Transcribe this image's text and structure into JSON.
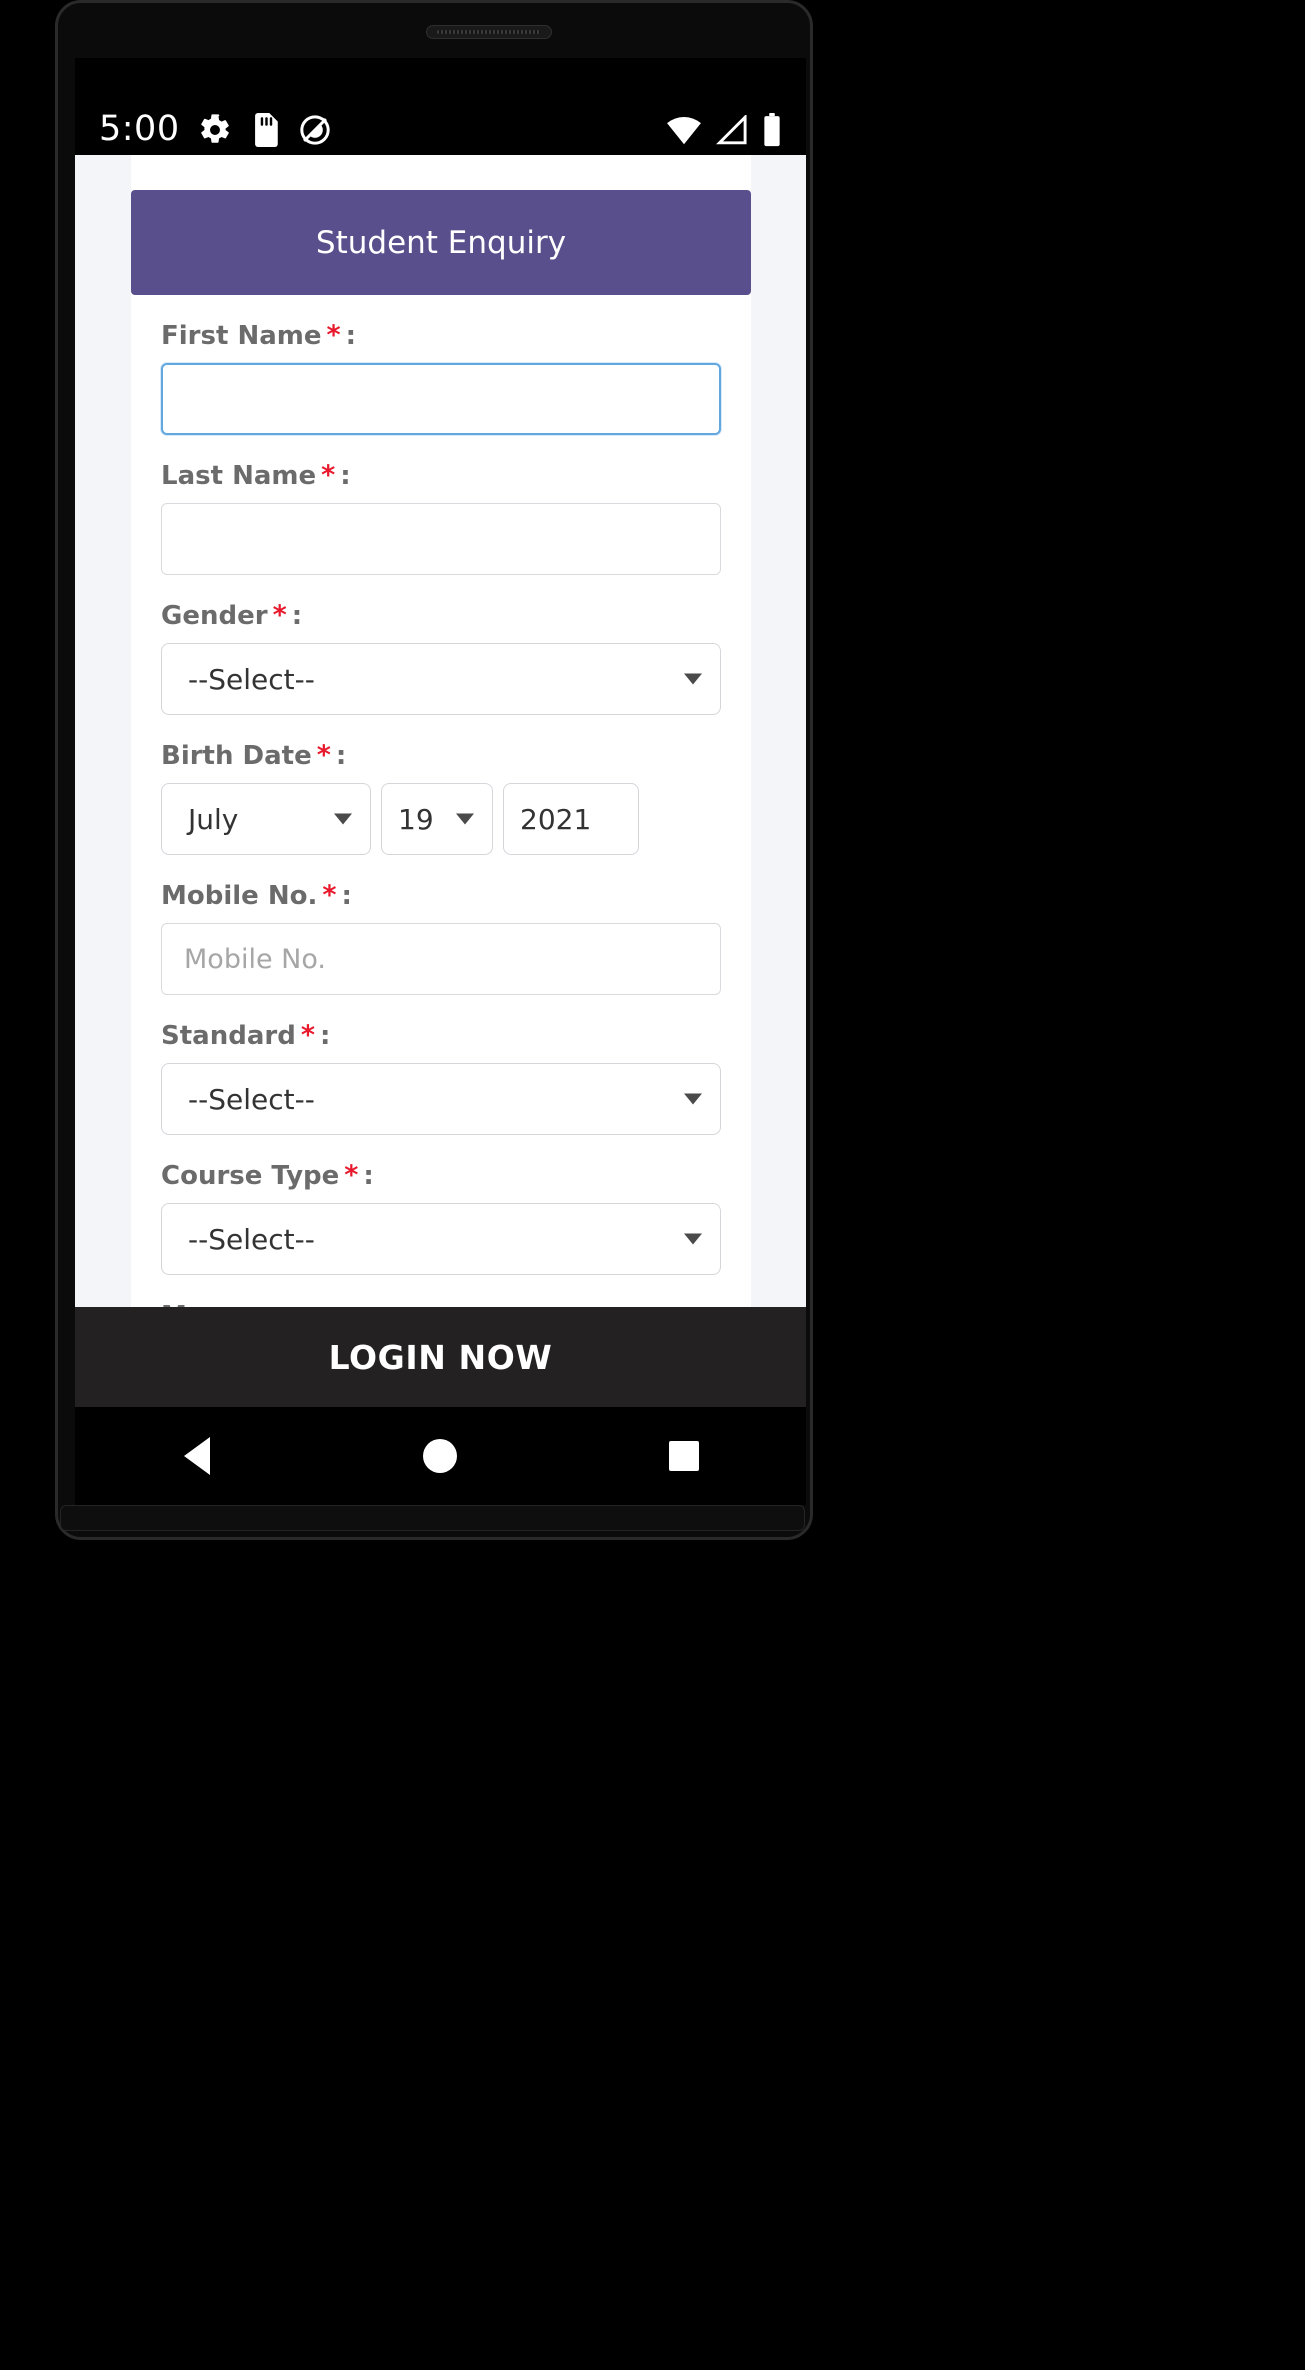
{
  "device": {
    "statusbar": {
      "clock": "5:00",
      "left_icons": [
        "gear-icon",
        "sd-card-icon",
        "android-q-icon"
      ],
      "right_icons": [
        "wifi-icon",
        "cell-signal-icon",
        "battery-icon"
      ]
    },
    "navigation": {
      "back_label": "back-triangle-icon",
      "home_label": "home-circle-icon",
      "recents_label": "recents-square-icon"
    }
  },
  "form": {
    "title": "Student Enquiry",
    "required_marker": "*",
    "colon": ":",
    "fields": {
      "first_name": {
        "label": "First Name",
        "required": true,
        "value": "",
        "placeholder": ""
      },
      "last_name": {
        "label": "Last Name",
        "required": true,
        "value": "",
        "placeholder": ""
      },
      "gender": {
        "label": "Gender",
        "required": true,
        "selected": "--Select--"
      },
      "birth_date": {
        "label": "Birth Date",
        "required": true,
        "month": "July",
        "day": "19",
        "year": "2021"
      },
      "mobile_no": {
        "label": "Mobile No.",
        "required": true,
        "value": "",
        "placeholder": "Mobile No."
      },
      "standard": {
        "label": "Standard",
        "required": true,
        "selected": "--Select--"
      },
      "course_type": {
        "label": "Course Type",
        "required": true,
        "selected": "--Select--"
      },
      "message": {
        "label": "Message",
        "required": false,
        "value": ""
      }
    }
  },
  "bottom_bar": {
    "login_label": "LOGIN NOW"
  },
  "colors": {
    "header_purple": "#594f8d",
    "required_red": "#e8192c",
    "login_bar_dark": "#232122",
    "focus_blue": "#62a8e0",
    "label_gray": "#6b6b6b",
    "page_background": "#f4f5f9"
  }
}
